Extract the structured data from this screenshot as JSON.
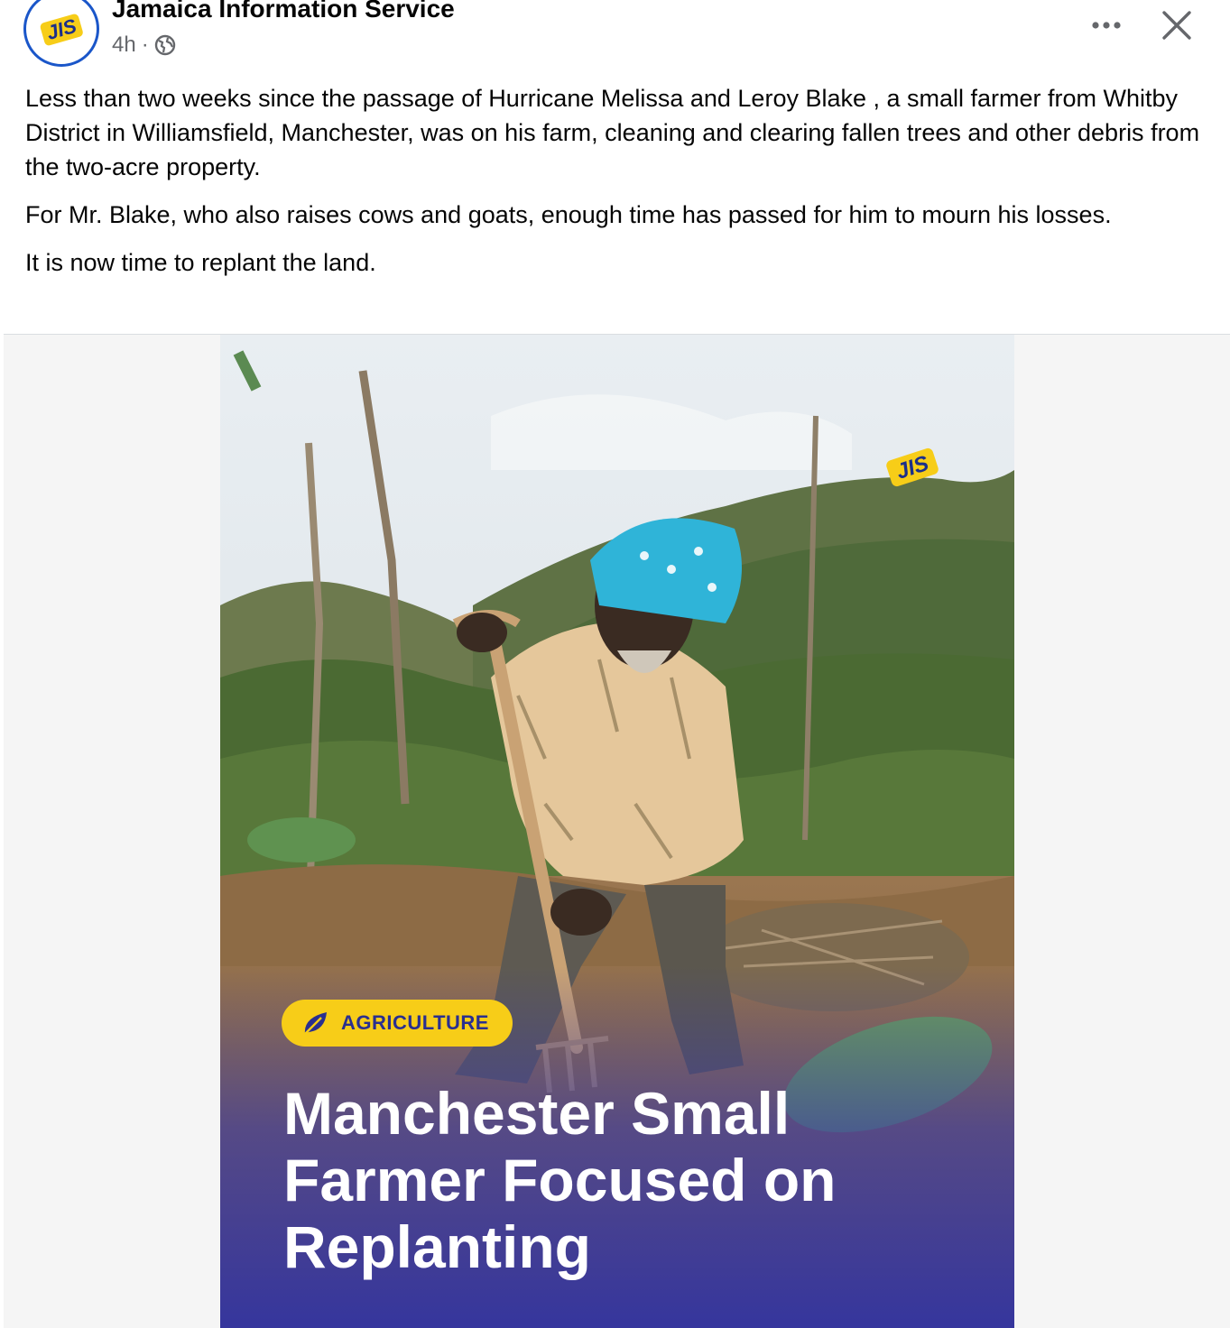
{
  "header": {
    "page_name": "Jamaica Information Service",
    "time": "4h",
    "separator": "·",
    "avatar_text": "JIS",
    "visibility_icon": "globe-icon",
    "more_icon": "more-options-icon",
    "close_icon": "close-icon"
  },
  "post": {
    "paragraphs": [
      "Less than two weeks since the passage of Hurricane Melissa and Leroy Blake , a small farmer from Whitby District  in Williamsfield, Manchester, was on his farm, cleaning and clearing  fallen trees and other debris from the two-acre property.",
      "For Mr. Blake, who also raises cows and goats, enough time has passed for him to mourn his losses.",
      "It is now time to replant the land."
    ]
  },
  "media": {
    "watermark": "JIS",
    "badge_icon": "leaf-icon",
    "badge_label": "AGRICULTURE",
    "headline_lines": [
      "Manchester Small",
      "Farmer Focused on",
      "Replanting"
    ]
  },
  "colors": {
    "brand_blue": "#1a56c9",
    "badge_yellow": "#f7cd18",
    "headline_gradient_bottom": "#3a3aa8",
    "meta_gray": "#65676b"
  }
}
